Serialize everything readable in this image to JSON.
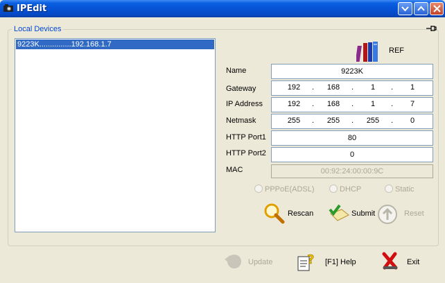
{
  "window": {
    "title": "IPEdit"
  },
  "group": {
    "label": "Local Devices"
  },
  "devices": [
    "9223K...............192.168.1.7"
  ],
  "ref": {
    "label": "REF"
  },
  "form": {
    "name_label": "Name",
    "name_value": "9223K",
    "gateway_label": "Gateway",
    "gateway": [
      "192",
      "168",
      "1",
      "1"
    ],
    "ip_label": "IP Address",
    "ip": [
      "192",
      "168",
      "1",
      "7"
    ],
    "netmask_label": "Netmask",
    "netmask": [
      "255",
      "255",
      "255",
      "0"
    ],
    "http1_label": "HTTP Port1",
    "http1_value": "80",
    "http2_label": "HTTP Port2",
    "http2_value": "0",
    "mac_label": "MAC",
    "mac_value": "00:92:24:00:00:9C",
    "dot": "."
  },
  "radios": {
    "pppoe": "PPPoE(ADSL)",
    "dhcp": "DHCP",
    "static": "Static"
  },
  "buttons": {
    "rescan": "Rescan",
    "submit": "Submit",
    "reset": "Reset",
    "update": "Update",
    "help": "[F1] Help",
    "exit": "Exit"
  },
  "colors": {
    "titlebar": "#0653d6",
    "selection": "#316ac5",
    "group_label": "#0046d5"
  }
}
